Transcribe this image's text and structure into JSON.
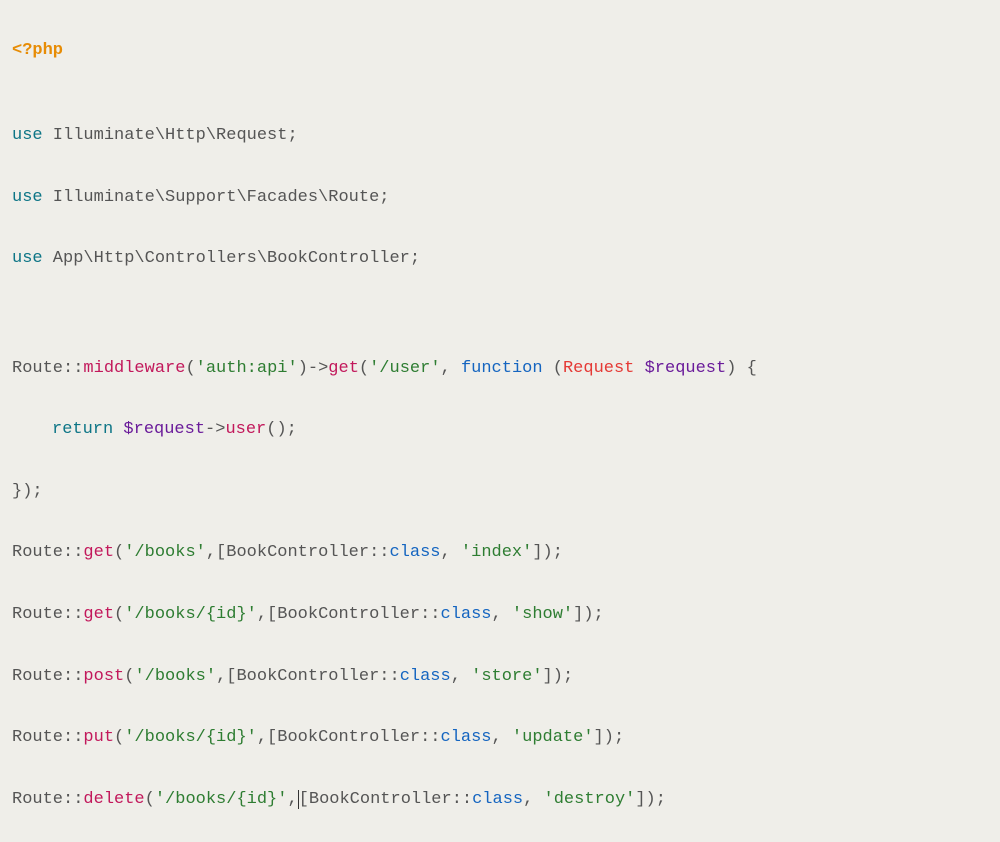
{
  "code": {
    "line1": {
      "php_open": "<?php"
    },
    "line3": {
      "use": "use",
      "path": " Illuminate\\Http\\Request;"
    },
    "line4": {
      "use": "use",
      "path": " Illuminate\\Support\\Facades\\Route;"
    },
    "line5": {
      "use": "use",
      "path": " App\\Http\\Controllers\\BookController;"
    },
    "line8": {
      "route": "Route",
      "dbl1": "::",
      "middleware": "middleware",
      "open1": "(",
      "auth": "'auth:api'",
      "close1": ")",
      "arrow1": "->",
      "get": "get",
      "open2": "(",
      "user": "'/user'",
      "comma": ", ",
      "function": "function",
      "space": " ",
      "open3": "(",
      "request_type": "Request",
      "space2": " ",
      "request_var": "$request",
      "close3": ")",
      "space3": " ",
      "brace": "{"
    },
    "line9": {
      "return": "return",
      "space": " ",
      "request_var": "$request",
      "arrow": "->",
      "user_method": "user",
      "parens": "();"
    },
    "line10": {
      "close": "});"
    },
    "line11": {
      "route": "Route",
      "dbl": "::",
      "method": "get",
      "open": "(",
      "path": "'/books'",
      "comma": ",[",
      "ctrl": "BookController",
      "dbl2": "::",
      "class": "class",
      "comma2": ", ",
      "action": "'index'",
      "close": "]);"
    },
    "line12": {
      "route": "Route",
      "dbl": "::",
      "method": "get",
      "open": "(",
      "path": "'/books/{id}'",
      "comma": ",[",
      "ctrl": "BookController",
      "dbl2": "::",
      "class": "class",
      "comma2": ", ",
      "action": "'show'",
      "close": "]);"
    },
    "line13": {
      "route": "Route",
      "dbl": "::",
      "method": "post",
      "open": "(",
      "path": "'/books'",
      "comma": ",[",
      "ctrl": "BookController",
      "dbl2": "::",
      "class": "class",
      "comma2": ", ",
      "action": "'store'",
      "close": "]);"
    },
    "line14": {
      "route": "Route",
      "dbl": "::",
      "method": "put",
      "open": "(",
      "path": "'/books/{id}'",
      "comma": ",[",
      "ctrl": "BookController",
      "dbl2": "::",
      "class": "class",
      "comma2": ", ",
      "action": "'update'",
      "close": "]);"
    },
    "line15": {
      "route": "Route",
      "dbl": "::",
      "method": "delete",
      "open": "(",
      "path": "'/books/{id}'",
      "comma": ",",
      "cursor": "",
      "bracket": "[",
      "ctrl": "BookController",
      "dbl2": "::",
      "class": "class",
      "comma2": ", ",
      "action": "'destroy'",
      "close": "]);"
    }
  }
}
